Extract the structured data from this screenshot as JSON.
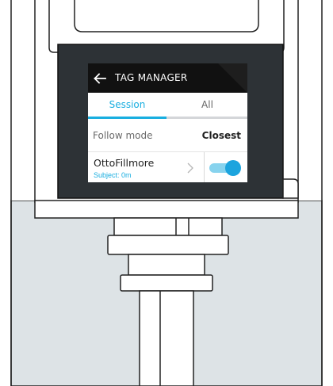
{
  "header": {
    "title": "TAG MANAGER",
    "back_icon": "arrow-left-icon"
  },
  "tabs": [
    {
      "label": "Session",
      "active": true
    },
    {
      "label": "All",
      "active": false
    }
  ],
  "follow_mode": {
    "label": "Follow mode",
    "value": "Closest"
  },
  "subject": {
    "name": "OttoFillmore",
    "detail": "Subject: 0m",
    "tracking_enabled": true
  },
  "colors": {
    "accent": "#19aee0",
    "header_bg": "#111111",
    "bezel": "#2d3236",
    "backdrop": "#dde3e6"
  }
}
